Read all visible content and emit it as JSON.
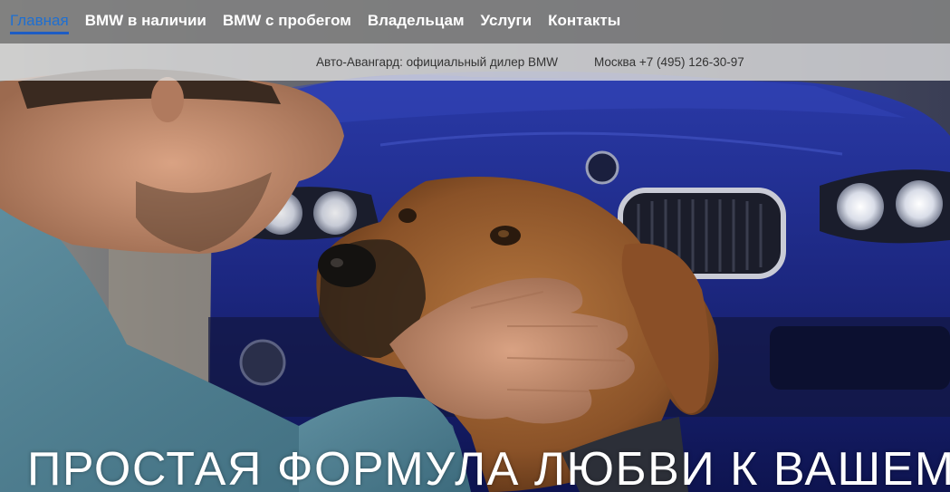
{
  "nav": {
    "items": [
      {
        "label": "Главная",
        "active": true
      },
      {
        "label": "BMW в наличии",
        "active": false
      },
      {
        "label": "BMW с пробегом",
        "active": false
      },
      {
        "label": "Владельцам",
        "active": false
      },
      {
        "label": "Услуги",
        "active": false
      },
      {
        "label": "Контакты",
        "active": false
      }
    ]
  },
  "info": {
    "dealer": "Авто-Авангард: официальный дилер BMW",
    "phone": "Москва +7 (495) 126-30-97"
  },
  "hero": {
    "headline": "ПРОСТАЯ ФОРМУЛА ЛЮБВИ К ВАШЕМУ"
  },
  "colors": {
    "nav_bg": "#808080",
    "active_link": "#1f6fd1",
    "car_blue": "#1e2a8a"
  }
}
